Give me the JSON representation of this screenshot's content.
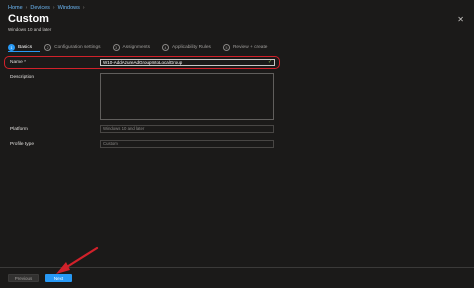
{
  "breadcrumb": {
    "home": "Home",
    "devices": "Devices",
    "windows": "Windows"
  },
  "header": {
    "title": "Custom",
    "subtitle": "Windows 10 and later",
    "close_icon": "close-icon"
  },
  "steps": [
    {
      "num": "1",
      "label": "Basics"
    },
    {
      "num": "2",
      "label": "Configuration settings"
    },
    {
      "num": "3",
      "label": "Assignments"
    },
    {
      "num": "4",
      "label": "Applicability Rules"
    },
    {
      "num": "5",
      "label": "Review + create"
    }
  ],
  "form": {
    "name_label": "Name *",
    "name_value": "W10-AddAzureAdGroupIntoLocalGroup",
    "description_label": "Description",
    "description_value": "",
    "platform_label": "Platform",
    "platform_value": "Windows 10 and later",
    "profile_type_label": "Profile type",
    "profile_type_value": "Custom"
  },
  "footer": {
    "previous_label": "Previous",
    "next_label": "Next"
  },
  "colors": {
    "accent": "#2899f5",
    "highlight": "#d1212a",
    "valid": "#92c353"
  }
}
